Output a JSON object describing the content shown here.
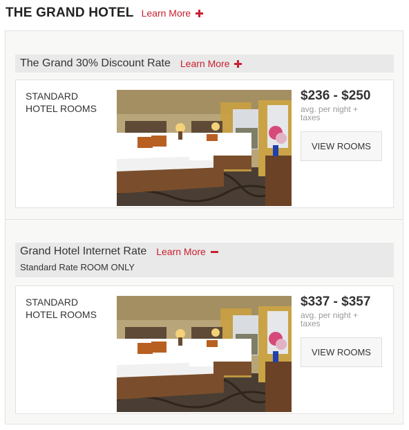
{
  "hotel": {
    "name": "THE GRAND HOTEL",
    "learn_more": "Learn More"
  },
  "rates": [
    {
      "name": "The Grand 30% Discount Rate",
      "learn_more": "Learn More",
      "toggle_icon": "plus-icon",
      "subtitle": "",
      "rooms": [
        {
          "type": "STANDARD HOTEL ROOMS",
          "price": "$236 - $250",
          "price_note": "avg. per night + taxes",
          "button": "VIEW ROOMS"
        }
      ]
    },
    {
      "name": "Grand Hotel Internet Rate",
      "learn_more": "Learn More",
      "toggle_icon": "minus-icon",
      "subtitle": "Standard Rate ROOM ONLY",
      "rooms": [
        {
          "type": "STANDARD HOTEL ROOMS",
          "price": "$337 - $357",
          "price_note": "avg. per night + taxes",
          "button": "VIEW ROOMS"
        }
      ]
    }
  ],
  "colors": {
    "accent": "#c8202f",
    "rate_bar": "#e9e9e9",
    "panel": "#f8f8f6"
  }
}
